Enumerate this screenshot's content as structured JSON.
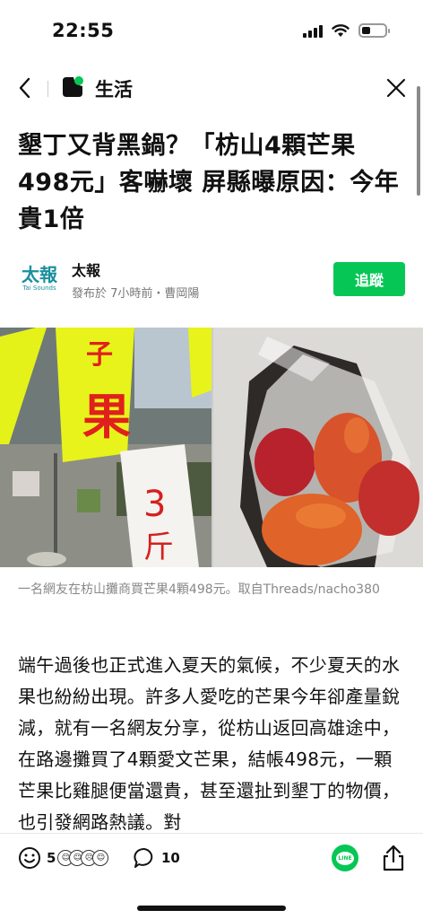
{
  "status_bar": {
    "time": "22:55"
  },
  "nav": {
    "channel_title": "生活",
    "logo_color": "#06c755"
  },
  "article": {
    "headline": "墾丁又背黑鍋？「枋山4顆芒果498元」客嚇壞 屏縣曝原因：今年貴1倍",
    "source": {
      "logo_text": "太報",
      "logo_subtext": "Tai Sounds",
      "name": "太報",
      "meta": "發布於 7小時前・曹岡陽",
      "follow_label": "追蹤"
    },
    "hero_sign_text": "3 斤",
    "caption": "一名網友在枋山攤商買芒果4顆498元。取自Threads/nacho380",
    "body": "端午過後也正式進入夏天的氣候，不少夏天的水果也紛紛出現。許多人愛吃的芒果今年卻產量銳減，就有一名網友分享，從枋山返回高雄途中，在路邊攤買了4顆愛文芒果，結帳498元，一顆芒果比雞腿便當還貴，甚至還扯到墾丁的物價，也引發網路熱議。對"
  },
  "toolbar": {
    "reaction_count": "5",
    "comment_count": "10",
    "line_label": "LINE",
    "accent": "#06c755"
  }
}
